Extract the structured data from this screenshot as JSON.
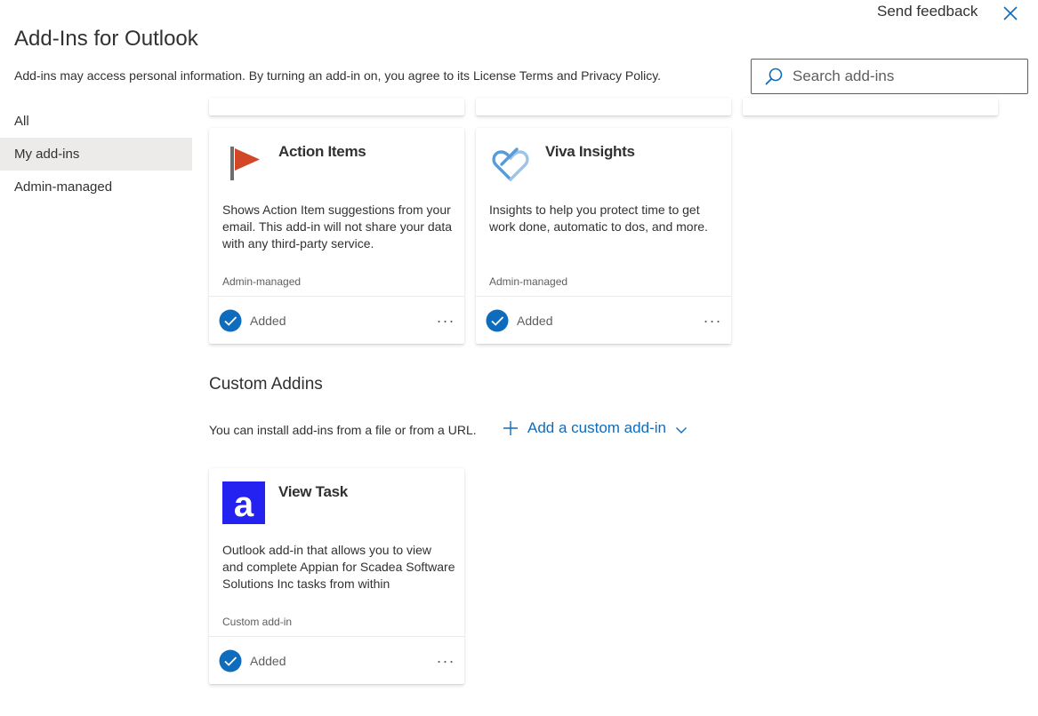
{
  "header": {
    "send_feedback": "Send feedback",
    "title": "Add-Ins for Outlook",
    "disclaimer": "Add-ins may access personal information. By turning an add-in on, you agree to its License Terms and Privacy Policy."
  },
  "search": {
    "placeholder": "Search add-ins",
    "value": ""
  },
  "nav": {
    "items": [
      {
        "label": "All"
      },
      {
        "label": "My add-ins"
      },
      {
        "label": "Admin-managed"
      }
    ]
  },
  "cards": [
    {
      "name": "Action Items",
      "description": "Shows Action Item suggestions from your email. This add-in will not share your data with any third-party service.",
      "category": "Admin-managed",
      "status": "Added",
      "more": "..."
    },
    {
      "name": "Viva Insights",
      "description": "Insights to help you protect time to get work done, automatic to dos, and more.",
      "category": "Admin-managed",
      "status": "Added",
      "more": "..."
    }
  ],
  "custom": {
    "section_title": "Custom Addins",
    "install_text": "You can install add-ins from a file or from a URL.",
    "add_label": "Add a custom add-in",
    "cards": [
      {
        "name": "View Task",
        "description": "Outlook add-in that allows you to view and complete Appian for Scadea Software Solutions Inc tasks from within",
        "category": "Custom add-in",
        "status": "Added",
        "more": "...",
        "logo_letter": "a"
      }
    ]
  },
  "colors": {
    "accent": "#0f6cbd",
    "check": "#0f6cbd",
    "action_flag": "#d24726",
    "viva": "#5b9bd5",
    "appian": "#2322f0"
  }
}
